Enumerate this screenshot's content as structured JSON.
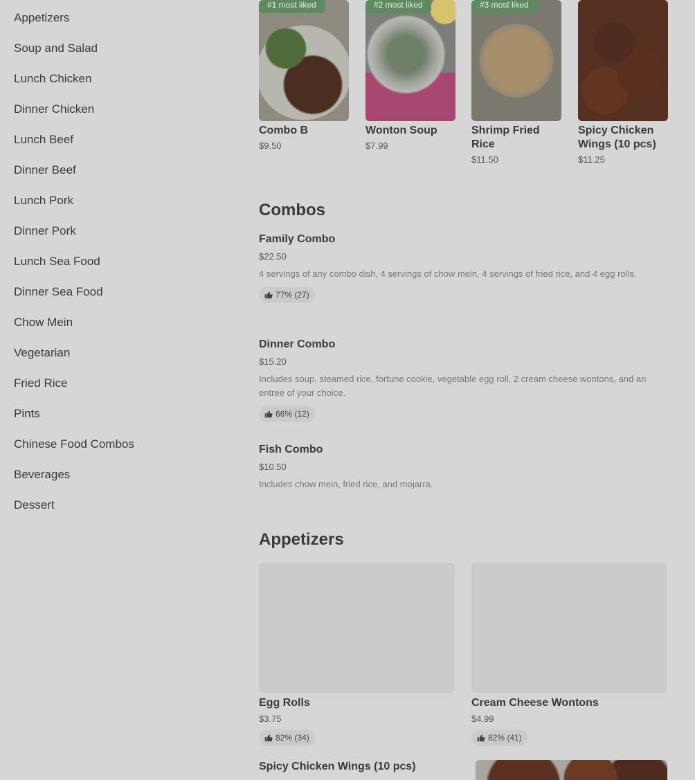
{
  "sidebar": {
    "items": [
      {
        "label": "Appetizers"
      },
      {
        "label": "Soup and Salad"
      },
      {
        "label": "Lunch Chicken"
      },
      {
        "label": "Dinner Chicken"
      },
      {
        "label": "Lunch Beef"
      },
      {
        "label": "Dinner Beef"
      },
      {
        "label": "Lunch Pork"
      },
      {
        "label": "Dinner Pork"
      },
      {
        "label": "Lunch Sea Food"
      },
      {
        "label": "Dinner Sea Food"
      },
      {
        "label": "Chow Mein"
      },
      {
        "label": "Vegetarian"
      },
      {
        "label": "Fried Rice"
      },
      {
        "label": "Pints"
      },
      {
        "label": "Chinese Food Combos"
      },
      {
        "label": "Beverages"
      },
      {
        "label": "Dessert"
      }
    ]
  },
  "popular": [
    {
      "badge": "#1 most liked",
      "name": "Combo B",
      "price": "$9.50"
    },
    {
      "badge": "#2 most liked",
      "name": "Wonton Soup",
      "price": "$7.99"
    },
    {
      "badge": "#3 most liked",
      "name": "Shrimp Fried Rice",
      "price": "$11.50"
    },
    {
      "badge": "",
      "name": "Spicy Chicken Wings (10 pcs)",
      "price": "$11.25"
    }
  ],
  "combos": {
    "title": "Combos",
    "items": [
      {
        "name": "Family Combo",
        "price": "$22.50",
        "description": "4 servings of any combo dish, 4 servings of chow mein, 4 servings of fried rice, and 4 egg rolls.",
        "rating": "77% (27)"
      },
      {
        "name": "Dinner Combo",
        "price": "$15.20",
        "description": "Includes soup, steamed rice, fortune cookie, vegetable egg roll, 2 cream cheese wontons, and an entree of your choice.",
        "rating": "66% (12)"
      },
      {
        "name": "Fish Combo",
        "price": "$10.50",
        "description": "Includes chow mein, fried rice, and mojarra."
      }
    ]
  },
  "appetizers": {
    "title": "Appetizers",
    "items": [
      {
        "name": "Egg Rolls",
        "price": "$3.75",
        "rating": "82% (34)"
      },
      {
        "name": "Cream Cheese Wontons",
        "price": "$4.99",
        "rating": "82% (41)"
      },
      {
        "name": "Spicy Chicken Wings (10 pcs)"
      }
    ]
  }
}
